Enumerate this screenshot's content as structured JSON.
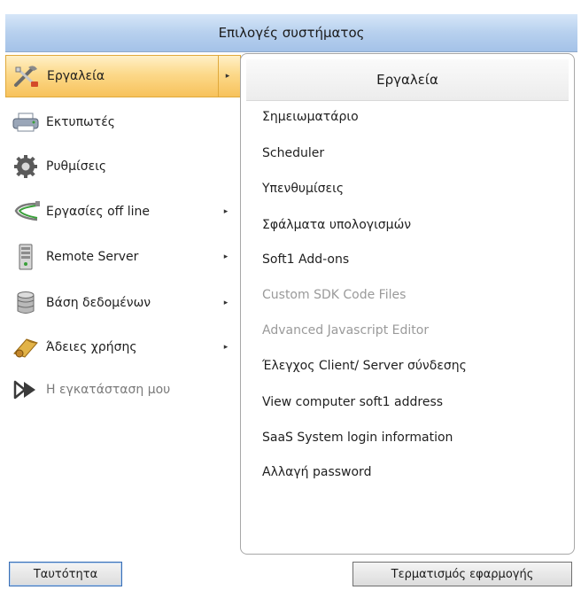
{
  "window": {
    "title": "Επιλογές συστήματος"
  },
  "sidebar": {
    "items": [
      {
        "label": "Εργαλεία",
        "icon": "tools-icon",
        "has_arrow": true,
        "active": true
      },
      {
        "label": "Εκτυπωτές",
        "icon": "printer-icon",
        "has_arrow": false
      },
      {
        "label": "Ρυθμίσεις",
        "icon": "gear-icon",
        "has_arrow": false
      },
      {
        "label": "Εργασίες off line",
        "icon": "cable-icon",
        "has_arrow": true
      },
      {
        "label": "Remote Server",
        "icon": "server-icon",
        "has_arrow": true
      },
      {
        "label": "Βάση δεδομένων",
        "icon": "database-icon",
        "has_arrow": true
      },
      {
        "label": "Άδειες χρήσης",
        "icon": "license-icon",
        "has_arrow": true
      },
      {
        "label": "Η εγκατάσταση μου",
        "icon": "forward-icon",
        "has_arrow": false,
        "disabled": true
      }
    ],
    "arrow_glyph": "▸"
  },
  "panel": {
    "title": "Εργαλεία",
    "items": [
      {
        "label": "Σημειωματάριο"
      },
      {
        "label": "Scheduler"
      },
      {
        "label": "Υπενθυμίσεις"
      },
      {
        "label": "Σφάλματα υπολογισμών"
      },
      {
        "label": "Soft1 Add-ons"
      },
      {
        "label": "Custom SDK Code Files",
        "disabled": true
      },
      {
        "label": "Advanced Javascript Editor",
        "disabled": true
      },
      {
        "label": "Έλεγχος Client/ Server σύνδεσης"
      },
      {
        "label": "View computer soft1 address"
      },
      {
        "label": "SaaS System login information"
      },
      {
        "label": "Αλλαγή password"
      }
    ]
  },
  "footer": {
    "identity_button": "Ταυτότητα",
    "exit_button": "Τερματισμός εφαρμογής"
  },
  "colors": {
    "title_bar": "#b7d0ee",
    "active_item": "#fcd98a",
    "disabled_text": "#9a9a9a"
  }
}
